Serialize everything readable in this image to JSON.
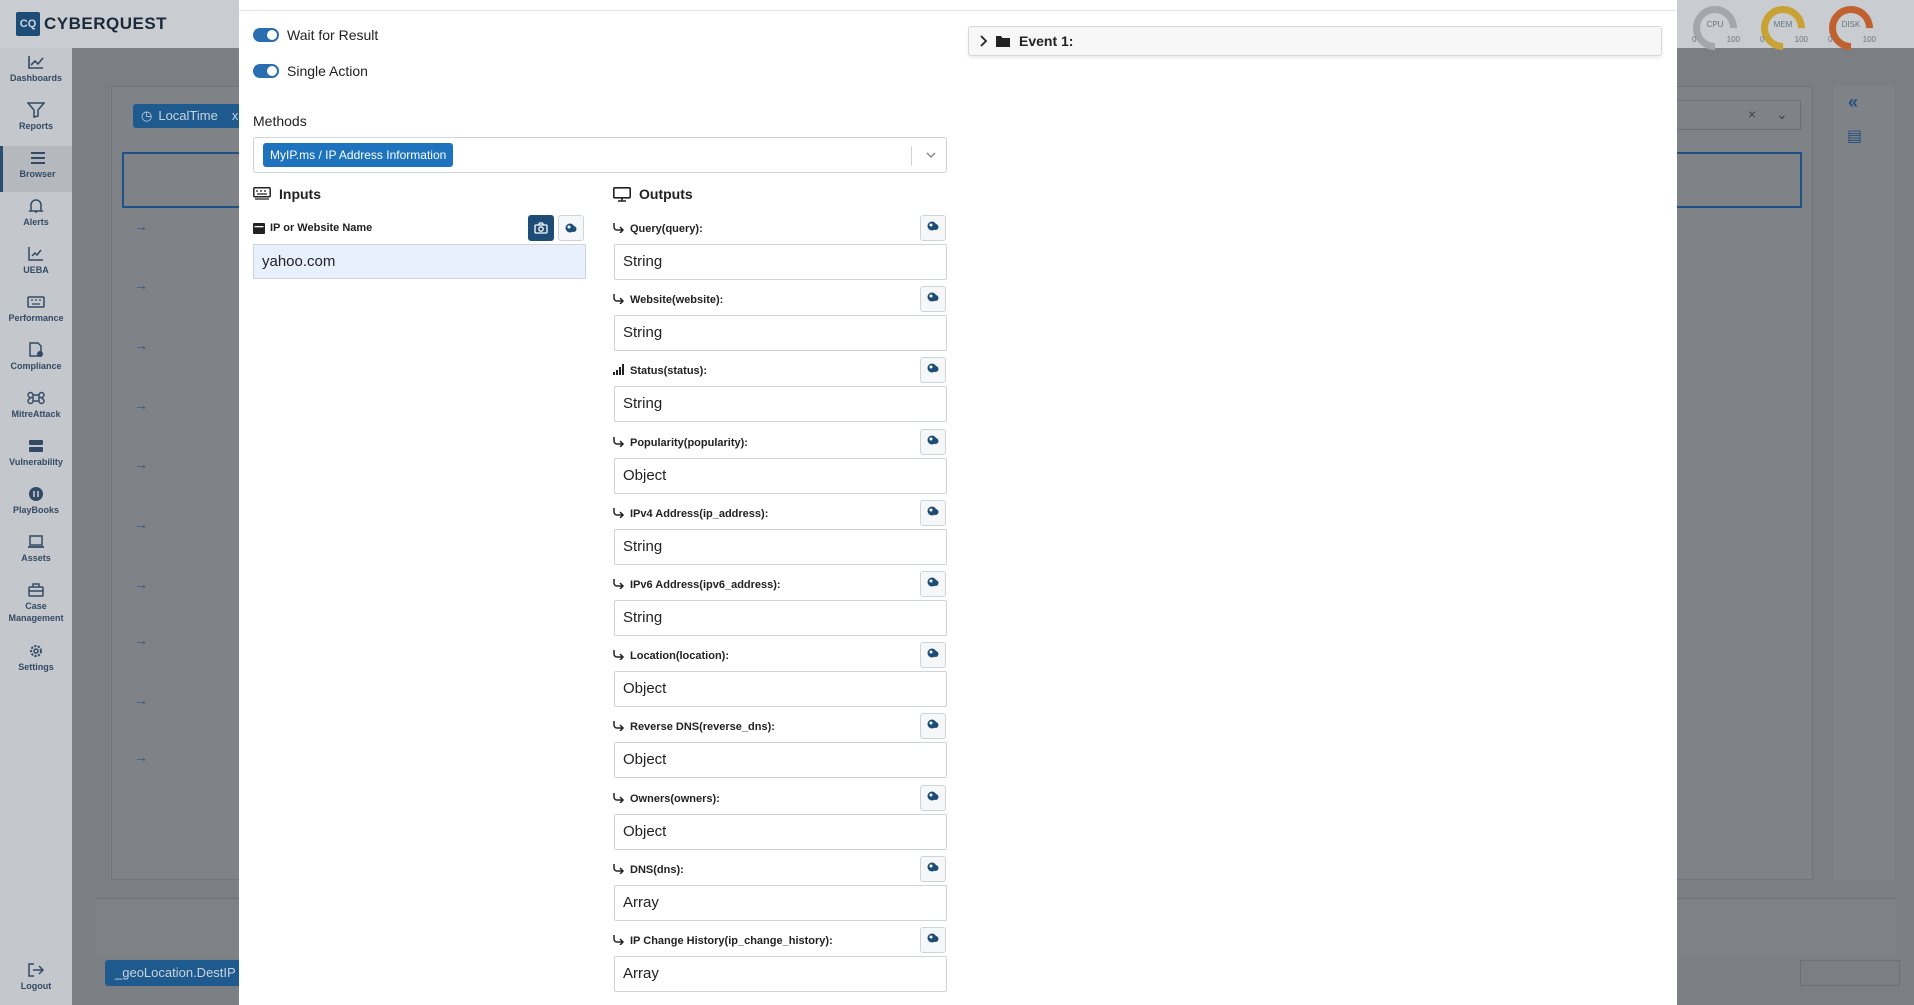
{
  "app": {
    "logo_mark": "CQ",
    "logo_text": "CYBERQUEST",
    "gauges": [
      {
        "label": "CPU",
        "min": "0",
        "max": "100",
        "color": "#a3a6aa"
      },
      {
        "label": "MEM",
        "min": "0",
        "max": "100",
        "color": "#c9a236"
      },
      {
        "label": "DISK",
        "min": "0",
        "max": "100",
        "color": "#c0622f"
      }
    ]
  },
  "sidebar": {
    "items": [
      {
        "label": "Dashboards"
      },
      {
        "label": "Reports"
      },
      {
        "label": "Browser"
      },
      {
        "label": "Alerts"
      },
      {
        "label": "UEBA"
      },
      {
        "label": "Performance"
      },
      {
        "label": "Compliance"
      },
      {
        "label": "MitreAttack"
      },
      {
        "label": "Vulnerability"
      },
      {
        "label": "PlayBooks"
      },
      {
        "label": "Assets"
      },
      {
        "label": "Case Management"
      },
      {
        "label": "Settings"
      },
      {
        "label": "Logout"
      }
    ]
  },
  "background": {
    "filter_chip": "LocalTime",
    "filter_chip_close": "x",
    "select_clear": "×",
    "geo_chip": "_geoLocation.DestIP"
  },
  "modal": {
    "wait_for_result": "Wait for Result",
    "single_action": "Single Action",
    "methods_label": "Methods",
    "method_selected": "MyIP.ms / IP Address Information",
    "inputs_title": "Inputs",
    "outputs_title": "Outputs",
    "input_field": {
      "label": "IP or Website Name",
      "value": "yahoo.com"
    },
    "outputs": [
      {
        "label": "Query(query):",
        "value": "String",
        "icon": "link-icon"
      },
      {
        "label": "Website(website):",
        "value": "String",
        "icon": "link-icon"
      },
      {
        "label": "Status(status):",
        "value": "String",
        "icon": "signal-icon"
      },
      {
        "label": "Popularity(popularity):",
        "value": "Object",
        "icon": "link-icon"
      },
      {
        "label": "IPv4 Address(ip_address):",
        "value": "String",
        "icon": "link-icon"
      },
      {
        "label": "IPv6 Address(ipv6_address):",
        "value": "String",
        "icon": "link-icon"
      },
      {
        "label": "Location(location):",
        "value": "Object",
        "icon": "link-icon"
      },
      {
        "label": "Reverse DNS(reverse_dns):",
        "value": "Object",
        "icon": "link-icon"
      },
      {
        "label": "Owners(owners):",
        "value": "Object",
        "icon": "link-icon"
      },
      {
        "label": "DNS(dns):",
        "value": "Array",
        "icon": "link-icon"
      },
      {
        "label": "IP Change History(ip_change_history):",
        "value": "Array",
        "icon": "link-icon"
      }
    ],
    "event_title": "Event 1:"
  }
}
